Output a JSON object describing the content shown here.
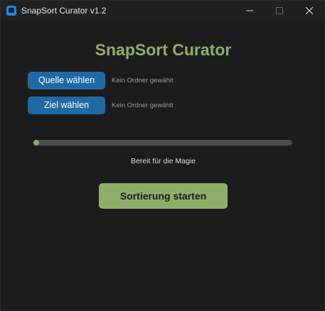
{
  "window": {
    "title": "SnapSort Curator v1.2"
  },
  "app": {
    "heading": "SnapSort Curator"
  },
  "source": {
    "button_label": "Quelle wählen",
    "path_label": "Kein Ordner gewählt"
  },
  "target": {
    "button_label": "Ziel wählen",
    "path_label": "Kein Ordner gewählt"
  },
  "progress": {
    "fraction": 0.0,
    "status": "Bereit für die Magie"
  },
  "actions": {
    "start_label": "Sortierung starten"
  },
  "colors": {
    "accent_green": "#8fae6a",
    "button_blue": "#1f6aa5",
    "background": "#1c1c1c"
  },
  "icons": {
    "app": "app-icon",
    "minimize": "minimize-icon",
    "maximize": "maximize-icon",
    "close": "close-icon"
  }
}
